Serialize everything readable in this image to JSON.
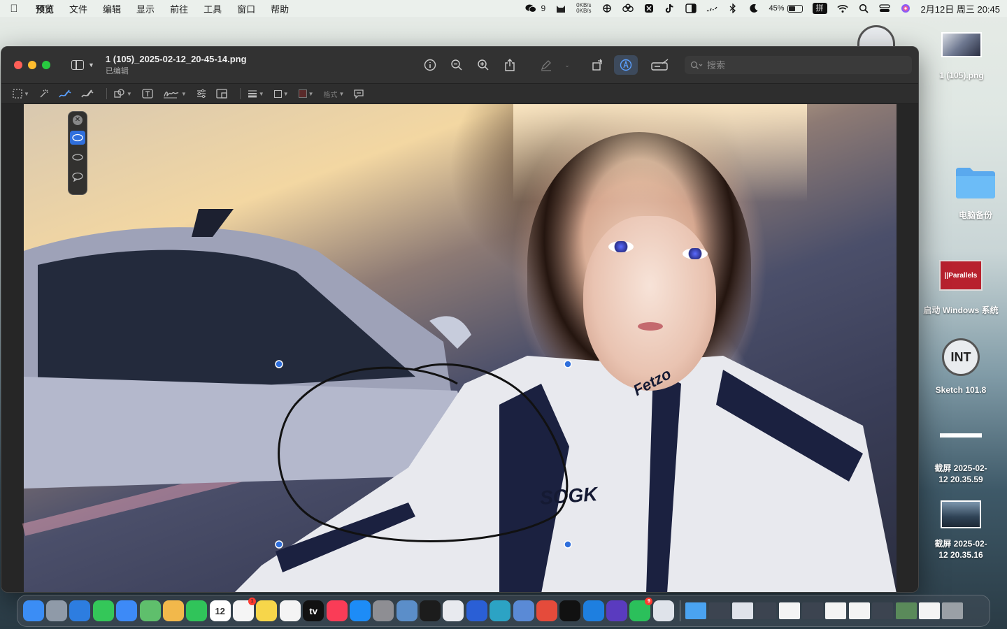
{
  "menubar": {
    "app_name": "预览",
    "items": [
      "文件",
      "编辑",
      "显示",
      "前往",
      "工具",
      "窗口",
      "帮助"
    ],
    "wechat_count": "9",
    "net_up": "0KB/s",
    "net_down": "0KB/s",
    "battery_pct": "45%",
    "battery_level": 0.45,
    "ime": "拼",
    "datetime": "2月12日 周三  20:45"
  },
  "desktop": {
    "items": [
      {
        "label": "1 (105).png",
        "icon": "image-thumbnail-icon"
      },
      {
        "label": "电脑备份",
        "icon": "folder-icon"
      },
      {
        "label": "启动 Windows 系统",
        "icon": "parallels-icon",
        "badge_text": "||Parallels"
      },
      {
        "label": "Sketch 101.8",
        "icon": "sketch-app-icon",
        "badge_text": "INT"
      },
      {
        "label": "截屏 2025-02-12 20.35.59",
        "icon": "screenshot-icon"
      },
      {
        "label": "截屏 2025-02-12 20.35.16",
        "icon": "screenshot-icon"
      }
    ]
  },
  "window": {
    "title": "1 (105)_2025-02-12_20-45-14.png",
    "subtitle": "已编辑",
    "search_placeholder": "搜索",
    "format_label": "格式",
    "accent": "#5ba0ff"
  },
  "photo": {
    "suit_logo": "SOGK",
    "collar_text": "Fetzo"
  },
  "dock": {
    "apps": [
      {
        "name": "finder-icon",
        "color": "#3b8df5"
      },
      {
        "name": "launchpad-icon",
        "color": "#8f9aa8"
      },
      {
        "name": "safari-icon",
        "color": "#2d7de0"
      },
      {
        "name": "messages-icon",
        "color": "#34c759"
      },
      {
        "name": "mail-icon",
        "color": "#3d8af7"
      },
      {
        "name": "maps-icon",
        "color": "#5fbf6c"
      },
      {
        "name": "photos-icon",
        "color": "#f2b84b"
      },
      {
        "name": "facetime-icon",
        "color": "#30c45a"
      },
      {
        "name": "calendar-icon",
        "color": "#ffffff",
        "text": "12"
      },
      {
        "name": "reminders-icon",
        "color": "#f5f5f5",
        "badge": "1"
      },
      {
        "name": "notes-icon",
        "color": "#f7d64a"
      },
      {
        "name": "freeform-icon",
        "color": "#f4f4f4"
      },
      {
        "name": "appletv-icon",
        "color": "#111111",
        "text": "tv"
      },
      {
        "name": "music-icon",
        "color": "#fa3c57"
      },
      {
        "name": "appstore-icon",
        "color": "#1d8cf7"
      },
      {
        "name": "settings-icon",
        "color": "#8e8e93"
      },
      {
        "name": "preview-icon",
        "color": "#5b8ec9"
      },
      {
        "name": "terminal-icon",
        "color": "#1c1c1c"
      },
      {
        "name": "parallels-icon",
        "color": "#e8eaef"
      },
      {
        "name": "quicktime-icon",
        "color": "#2a5fd6"
      },
      {
        "name": "edge-icon",
        "color": "#2ca3c4"
      },
      {
        "name": "box-icon",
        "color": "#5a8ad6"
      },
      {
        "name": "xmind-icon",
        "color": "#e54b3b"
      },
      {
        "name": "tiktok-icon",
        "color": "#111111"
      },
      {
        "name": "windows-icon",
        "color": "#1e7fe0"
      },
      {
        "name": "vpn-icon",
        "color": "#5a3bbf"
      },
      {
        "name": "wechat-icon",
        "color": "#2bc05b",
        "badge": "9"
      },
      {
        "name": "remote-desktop-icon",
        "color": "#dfe3ea"
      }
    ],
    "thumbs": [
      {
        "name": "downloads-folder-icon",
        "color": "#4aa3f0"
      },
      {
        "name": "recent-thumb-1",
        "color": "#3c4450"
      },
      {
        "name": "recent-thumb-2",
        "color": "#dfe3ea"
      },
      {
        "name": "recent-thumb-3",
        "color": "#3c4450"
      },
      {
        "name": "recent-thumb-4",
        "color": "#f4f4f4"
      },
      {
        "name": "recent-thumb-5",
        "color": "#3c4450"
      },
      {
        "name": "recent-thumb-6",
        "color": "#f4f4f4"
      },
      {
        "name": "recent-thumb-7",
        "color": "#f4f4f4"
      },
      {
        "name": "recent-thumb-8",
        "color": "#3c4450"
      },
      {
        "name": "recent-thumb-9",
        "color": "#5a8a5a"
      },
      {
        "name": "recent-thumb-10",
        "color": "#f4f4f4"
      },
      {
        "name": "trash-icon",
        "color": "#9aa0a6"
      }
    ]
  }
}
